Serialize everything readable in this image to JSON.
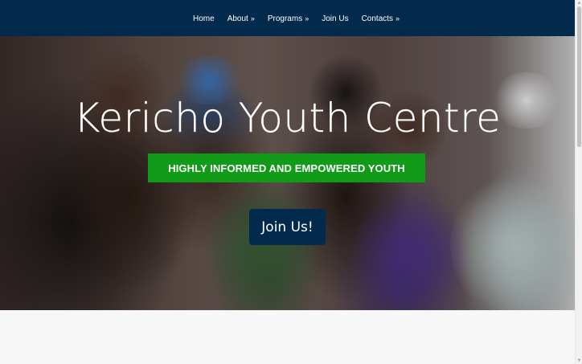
{
  "nav": {
    "items": [
      {
        "label": "Home",
        "has_dropdown": false
      },
      {
        "label": "About",
        "has_dropdown": true
      },
      {
        "label": "Programs",
        "has_dropdown": true
      },
      {
        "label": "Join Us",
        "has_dropdown": false
      },
      {
        "label": "Contacts",
        "has_dropdown": true
      }
    ],
    "dropdown_glyph": "»"
  },
  "hero": {
    "title": "Kericho Youth Centre",
    "tagline": "HIGHLY INFORMED AND EMPOWERED YOUTH",
    "cta_label": "Join Us!"
  },
  "colors": {
    "navbar": "#022a4c",
    "tagline_bg": "#119b19",
    "cta_bg": "#022a4c"
  }
}
